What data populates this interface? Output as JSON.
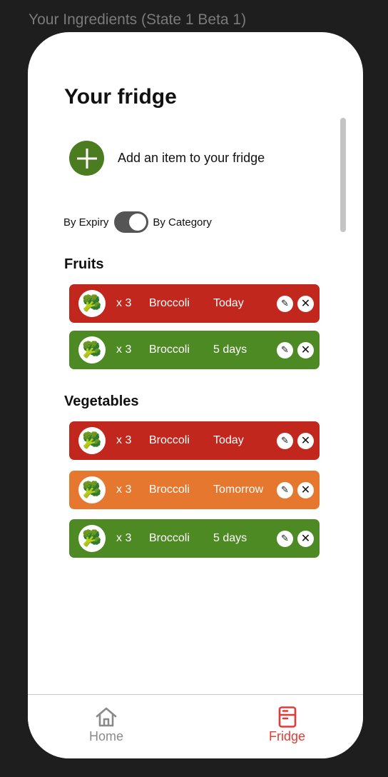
{
  "frame_label": "Your Ingredients (State 1 Beta 1)",
  "page": {
    "title": "Your fridge",
    "add_label": "Add an item to your fridge",
    "toggle": {
      "left_label": "By Expiry",
      "right_label": "By Category",
      "selected": "By Category"
    }
  },
  "sections": [
    {
      "title": "Fruits",
      "items": [
        {
          "qty": "x 3",
          "name": "Broccoli",
          "expiry": "Today",
          "status": "red"
        },
        {
          "qty": "x 3",
          "name": "Broccoli",
          "expiry": "5 days",
          "status": "green"
        }
      ]
    },
    {
      "title": "Vegetables",
      "items": [
        {
          "qty": "x 3",
          "name": "Broccoli",
          "expiry": "Today",
          "status": "red"
        },
        {
          "qty": "x 3",
          "name": "Broccoli",
          "expiry": "Tomorrow",
          "status": "orange"
        },
        {
          "qty": "x 3",
          "name": "Broccoli",
          "expiry": "5 days",
          "status": "green"
        }
      ]
    }
  ],
  "nav": {
    "home": {
      "label": "Home",
      "icon": "home-icon",
      "active": false
    },
    "fridge": {
      "label": "Fridge",
      "icon": "fridge-icon",
      "active": true
    }
  },
  "colors": {
    "red": "#c1271d",
    "orange": "#e5772e",
    "green": "#4e8a23",
    "accent": "#e53935",
    "add_button": "#4b7c1f"
  }
}
